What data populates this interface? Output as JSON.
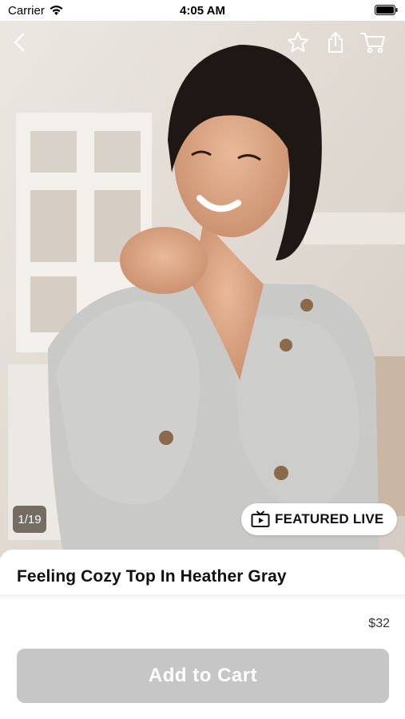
{
  "status_bar": {
    "carrier": "Carrier",
    "time": "4:05 AM"
  },
  "gallery": {
    "counter": "1/19",
    "badge_label": "FEATURED LIVE"
  },
  "product": {
    "title": "Feeling Cozy Top In Heather Gray",
    "price": "$32"
  },
  "actions": {
    "add_to_cart_label": "Add to Cart"
  },
  "icons": {
    "back": "back-chevron-icon",
    "favorite": "star-icon",
    "share": "share-icon",
    "cart": "cart-icon",
    "live": "live-tv-icon"
  },
  "colors": {
    "button_disabled": "#c6c6c6",
    "badge_bg": "#ffffff",
    "counter_bg": "#463c32"
  }
}
